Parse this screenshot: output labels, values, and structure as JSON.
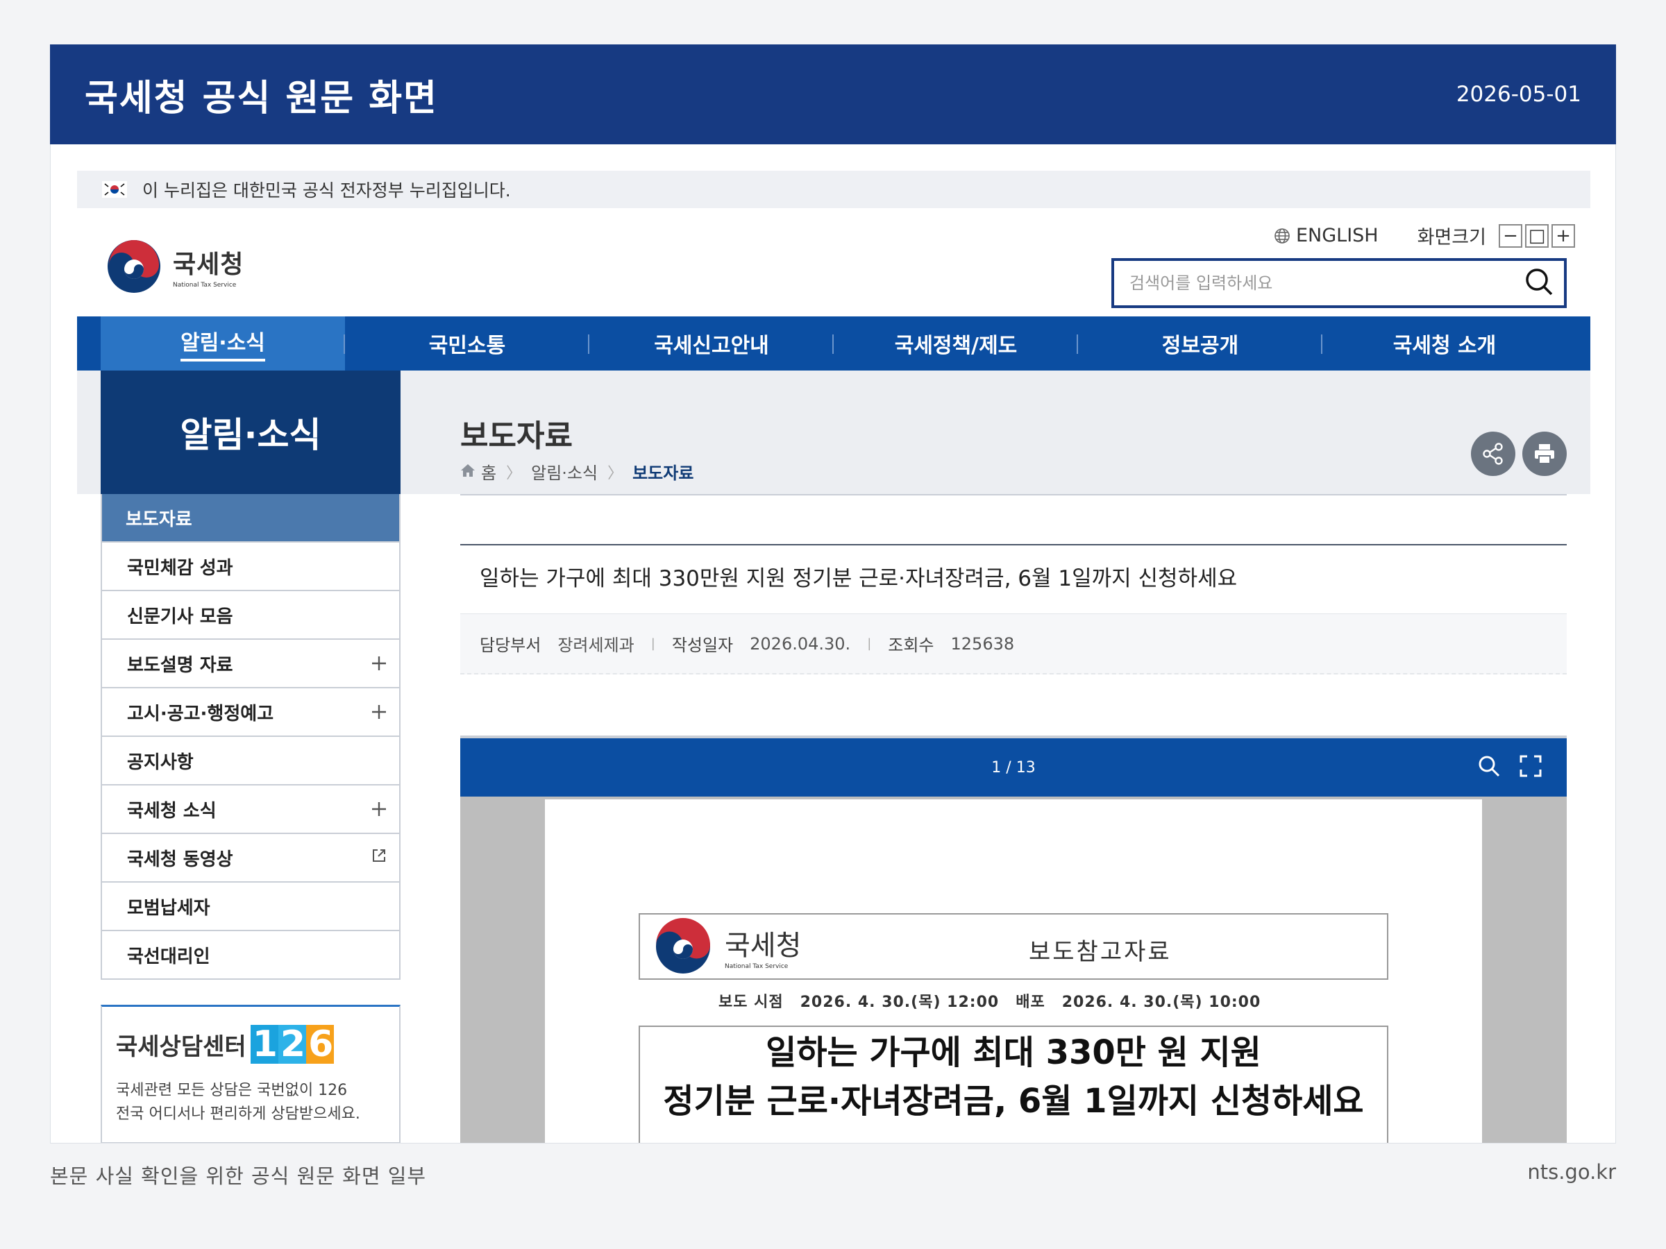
{
  "frame": {
    "title": "국세청 공식 원문 화면",
    "date": "2026-05-01",
    "caption": "본문 사실 확인을 위한 공식 원문 화면 일부",
    "domain": "nts.go.kr"
  },
  "gov_bar": {
    "text": "이 누리집은 대한민국 공식 전자정부 누리집입니다."
  },
  "logo": {
    "kr": "국세청",
    "en": "National Tax Service"
  },
  "util": {
    "english": "ENGLISH",
    "zoom_label": "화면크기",
    "zoom_out": "−",
    "zoom_reset": "□",
    "zoom_in": "+"
  },
  "search": {
    "placeholder": "검색어를 입력하세요"
  },
  "gnb": [
    {
      "label": "알림·소식"
    },
    {
      "label": "국민소통"
    },
    {
      "label": "국세신고안내"
    },
    {
      "label": "국세정책/제도"
    },
    {
      "label": "정보공개"
    },
    {
      "label": "국세청 소개"
    }
  ],
  "lnb": {
    "title": "알림·소식",
    "items": [
      {
        "label": "보도자료"
      },
      {
        "label": "국민체감 성과"
      },
      {
        "label": "신문기사 모음"
      },
      {
        "label": "보도설명 자료"
      },
      {
        "label": "고시·공고·행정예고"
      },
      {
        "label": "공지사항"
      },
      {
        "label": "국세청 소식"
      },
      {
        "label": "국세청 동영상"
      },
      {
        "label": "모범납세자"
      },
      {
        "label": "국선대리인"
      }
    ]
  },
  "counsel": {
    "title": "국세상담센터",
    "num1": "1",
    "num2": "2",
    "num3": "6",
    "desc1": "국세관련 모든 상담은 국번없이 126",
    "desc2": "전국 어디서나 편리하게 상담받으세요."
  },
  "content": {
    "title": "보도자료",
    "breadcrumb": {
      "home": "홈",
      "section": "알림·소식",
      "current": "보도자료"
    }
  },
  "article": {
    "title": "일하는 가구에 최대 330만원 지원 정기분 근로·자녀장려금, 6월 1일까지 신청하세요",
    "dept_label": "담당부서",
    "dept": "장려세제과",
    "date_label": "작성일자",
    "date": "2026.04.30.",
    "views_label": "조회수",
    "views": "125638"
  },
  "viewer": {
    "page": "1 / 13",
    "doc": {
      "logo_kr": "국세청",
      "logo_en": "National Tax Service",
      "type": "보도참고자료",
      "release_label": "보도 시점",
      "release_time": "2026. 4. 30.(목) 12:00",
      "dist_label": "배포",
      "dist_time": "2026. 4. 30.(목) 10:00",
      "title_line1": "일하는 가구에 최대 330만 원 지원",
      "title_line2": "정기분 근로·자녀장려금, 6월 1일까지 신청하세요"
    }
  }
}
